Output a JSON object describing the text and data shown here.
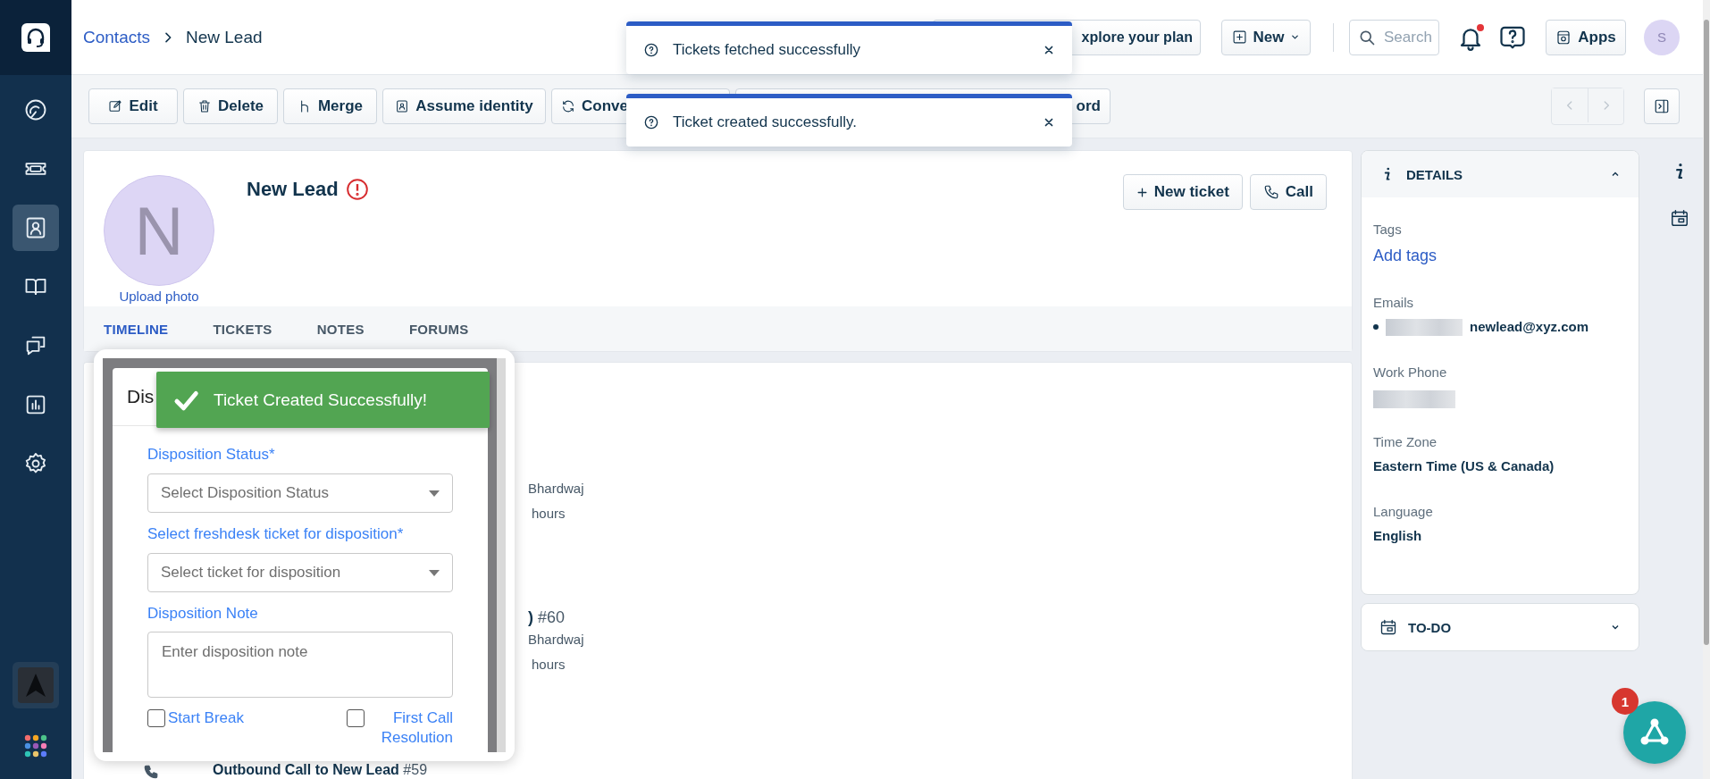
{
  "sidebar": {
    "items": [
      {
        "kind": "gauge",
        "selected": false
      },
      {
        "kind": "ticket",
        "selected": false
      },
      {
        "kind": "contact",
        "selected": true
      },
      {
        "kind": "book",
        "selected": false
      },
      {
        "kind": "chat",
        "selected": false
      },
      {
        "kind": "reports",
        "selected": false
      },
      {
        "kind": "settings",
        "selected": false
      }
    ]
  },
  "header": {
    "breadcrumb": {
      "parent": "Contacts",
      "current": "New Lead"
    },
    "plan_button": "xplore your plan",
    "new_button": "New",
    "search": {
      "placeholder": "Search"
    },
    "notifications": {
      "unread": true
    },
    "apps_button": "Apps",
    "avatar": "S"
  },
  "toolbar": {
    "actions": [
      {
        "kind": "edit",
        "label": "Edit"
      },
      {
        "kind": "delete",
        "label": "Delete"
      },
      {
        "kind": "merge",
        "label": "Merge"
      },
      {
        "kind": "identity",
        "label": "Assume identity"
      },
      {
        "kind": "convert",
        "label": "Conve"
      },
      {
        "kind": "plain",
        "label": "ord"
      }
    ]
  },
  "toasts": [
    {
      "text": "Tickets fetched successfully"
    },
    {
      "text": "Ticket created successfully."
    }
  ],
  "contact": {
    "avatar_letter": "N",
    "upload_label": "Upload photo",
    "name": "New Lead",
    "warning": true,
    "actions": [
      {
        "kind": "new",
        "label": "New ticket"
      },
      {
        "kind": "call",
        "label": "Call"
      }
    ],
    "tabs": [
      {
        "label": "TIMELINE",
        "selected": true
      },
      {
        "label": "TICKETS",
        "selected": false
      },
      {
        "label": "NOTES",
        "selected": false
      },
      {
        "label": "FORUMS",
        "selected": false
      }
    ]
  },
  "timeline": {
    "entries": [
      {
        "kind": "partial",
        "author": "Bhardwaj",
        "time": "hours"
      },
      {
        "kind": "partial",
        "title": ")",
        "number": "#60",
        "author": "Bhardwaj",
        "time": "hours"
      },
      {
        "kind": "full",
        "title": "Outbound Call to New Lead",
        "number": "#59"
      }
    ]
  },
  "details": {
    "title": "DETAILS",
    "expanded": true,
    "fields": [
      {
        "kind": "link",
        "label": "Tags",
        "value": "Add tags"
      },
      {
        "kind": "email",
        "label": "Emails",
        "value": "newlead@xyz.com"
      },
      {
        "kind": "redacted",
        "label": "Work Phone"
      },
      {
        "kind": "text",
        "label": "Time Zone",
        "value": "Eastern Time (US & Canada)"
      },
      {
        "kind": "text",
        "label": "Language",
        "value": "English"
      }
    ]
  },
  "todo": {
    "title": "TO-DO",
    "expanded": false
  },
  "popup": {
    "title": "Dis",
    "toast": "Ticket Created Successfully!",
    "fields": [
      {
        "kind": "select",
        "label": "Disposition Status*",
        "placeholder": "Select Disposition Status"
      },
      {
        "kind": "select",
        "label": "Select freshdesk ticket for disposition*",
        "placeholder": "Select ticket for disposition"
      },
      {
        "kind": "textarea",
        "label": "Disposition Note",
        "placeholder": "Enter disposition note"
      }
    ],
    "checkboxes": [
      {
        "label": "Start Break",
        "checked": false
      },
      {
        "label": "First Call Resolution",
        "checked": false
      }
    ]
  },
  "launcher": {
    "count": "1"
  }
}
